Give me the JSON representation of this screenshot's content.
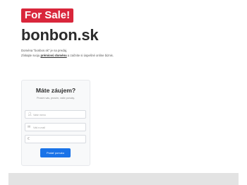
{
  "badge": "For Sale!",
  "domain": "bonbon.sk",
  "description": {
    "line1": "Doména \"bonbon.sk\" je na predaj.",
    "line2_prefix": "Získajte svoju ",
    "line2_link": "prémiovú doménu",
    "line2_suffix": " a začnite si úspešné online biznis."
  },
  "form": {
    "title": "Máte záujem?",
    "subtitle": "Prosím vás, prosím, vaše ponuky.",
    "name_placeholder": "Vaše meno",
    "email_placeholder": "Váš e-mail",
    "offer_placeholder": "",
    "submit_label": "Podať ponuku"
  },
  "icons": {
    "name": "user-icon",
    "email": "envelope-icon",
    "offer": "euro-icon"
  },
  "colors": {
    "badge": "#d9263b",
    "button": "#1a73e8"
  }
}
